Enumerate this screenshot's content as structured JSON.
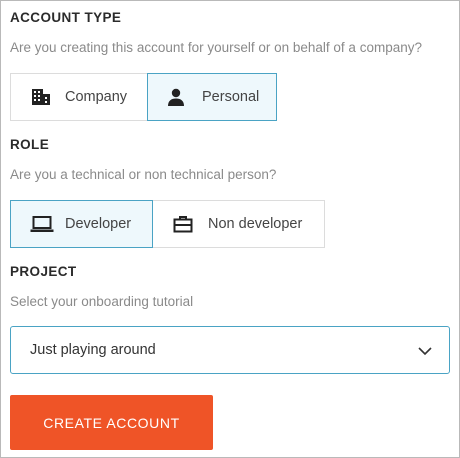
{
  "account_type": {
    "title": "ACCOUNT TYPE",
    "subtitle": "Are you creating this account for yourself or on behalf of a company?",
    "options": [
      {
        "label": "Company",
        "icon": "building-icon",
        "selected": false
      },
      {
        "label": "Personal",
        "icon": "person-icon",
        "selected": true
      }
    ]
  },
  "role": {
    "title": "ROLE",
    "subtitle": "Are you a technical or non technical person?",
    "options": [
      {
        "label": "Developer",
        "icon": "laptop-icon",
        "selected": true
      },
      {
        "label": "Non developer",
        "icon": "briefcase-icon",
        "selected": false
      }
    ]
  },
  "project": {
    "title": "PROJECT",
    "subtitle": "Select your onboarding tutorial",
    "selected_value": "Just playing around"
  },
  "actions": {
    "create_account_label": "CREATE ACCOUNT"
  },
  "colors": {
    "accent": "#ef5427",
    "selected_border": "#4aa3c4",
    "selected_bg": "#eef8fc"
  }
}
